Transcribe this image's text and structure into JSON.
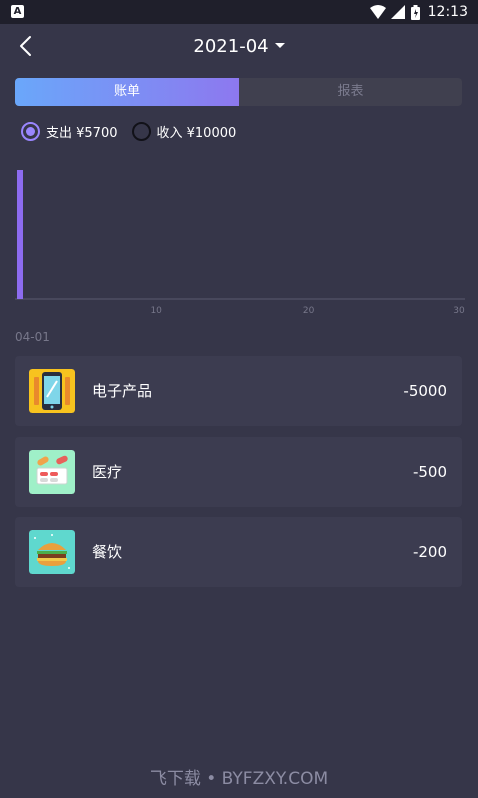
{
  "status_bar": {
    "time": "12:13",
    "notification_icon": "A"
  },
  "header": {
    "month": "2021-04",
    "back_icon": "chevron-left-icon",
    "caret_icon": "caret-down-icon"
  },
  "tabs": [
    {
      "label": "账单",
      "active": true
    },
    {
      "label": "报表",
      "active": false
    }
  ],
  "type_filter": {
    "expense": {
      "label": "支出 ¥5700",
      "checked": true
    },
    "income": {
      "label": "收入 ¥10000",
      "checked": false
    }
  },
  "chart_data": {
    "type": "bar",
    "x": [
      1
    ],
    "values": [
      5700
    ],
    "xlim": [
      1,
      30
    ],
    "xticks": [
      "10",
      "20",
      "30"
    ],
    "grid": false,
    "color": "#8d6cf0"
  },
  "list": {
    "date": "04-01",
    "records": [
      {
        "name": "电子产品",
        "amount": "-5000",
        "icon": "phone-icon"
      },
      {
        "name": "医疗",
        "amount": "-500",
        "icon": "medicine-icon"
      },
      {
        "name": "餐饮",
        "amount": "-200",
        "icon": "burger-icon"
      }
    ]
  },
  "watermark": "飞下载 • BYFZXY.COM",
  "colors": {
    "background": "#363649",
    "card": "#3c3c50",
    "accent": "#9a86ff",
    "gradient_start": "#6aa7fa",
    "gradient_end": "#8d78ef"
  }
}
